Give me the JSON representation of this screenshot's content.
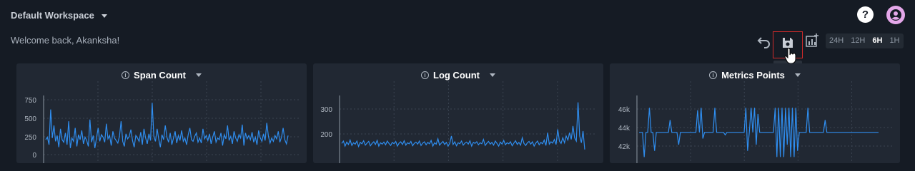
{
  "header": {
    "workspace_label": "Default Workspace",
    "welcome_text": "Welcome back, Akanksha!",
    "help_glyph": "?"
  },
  "toolbar": {
    "save_tooltip": "Save",
    "time_ranges": [
      "24H",
      "12H",
      "6H",
      "1H"
    ],
    "active_range": "6H"
  },
  "panels": [
    {
      "title": "Span Count",
      "info_glyph": "i"
    },
    {
      "title": "Log Count",
      "info_glyph": "i"
    },
    {
      "title": "Metrics Points",
      "info_glyph": "i"
    }
  ],
  "chart_data": [
    {
      "type": "line",
      "title": "Span Count",
      "yticks": [
        "750",
        "500",
        "250",
        "0"
      ],
      "ylim": [
        0,
        850
      ],
      "series": [
        {
          "color": "#2f8ef0",
          "values": [
            280,
            310,
            220,
            640,
            300,
            450,
            260,
            330,
            190,
            410,
            280,
            250,
            360,
            220,
            500,
            180,
            300,
            260,
            420,
            200,
            340,
            280,
            390,
            230,
            310,
            270,
            200,
            520,
            250,
            330,
            180,
            300,
            420,
            260,
            340,
            310,
            250,
            470,
            290,
            330,
            210,
            380,
            300,
            270,
            240,
            320,
            500,
            260,
            200,
            350,
            290,
            320,
            400,
            270,
            190,
            330,
            300,
            260,
            370,
            220,
            410,
            300,
            230,
            350,
            270,
            720,
            320,
            260,
            410,
            290,
            190,
            340,
            280,
            450,
            310,
            250,
            360,
            220,
            300,
            380,
            240,
            330,
            270,
            390,
            260,
            300,
            220,
            340,
            420,
            280,
            260,
            320,
            360,
            250,
            300,
            240,
            410,
            290,
            330,
            270,
            350,
            230,
            310,
            380,
            250,
            300,
            280,
            360,
            210,
            340,
            290,
            450,
            270,
            320,
            230,
            380,
            300,
            260,
            340,
            300,
            460,
            210,
            360,
            290,
            330,
            280,
            370,
            250,
            310,
            220,
            390,
            300,
            260,
            350,
            270,
            480,
            320,
            240,
            300,
            260,
            330,
            290,
            380,
            250,
            310,
            420,
            280,
            230,
            330
          ]
        }
      ],
      "grid": true
    },
    {
      "type": "line",
      "title": "Log Count",
      "yticks": [
        "300",
        "200"
      ],
      "ylim": [
        150,
        330
      ],
      "series": [
        {
          "color": "#2f8ef0",
          "values": [
            198,
            205,
            190,
            202,
            195,
            208,
            192,
            200,
            196,
            205,
            189,
            201,
            197,
            206,
            193,
            199,
            204,
            191,
            198,
            203,
            195,
            207,
            190,
            200,
            196,
            202,
            194,
            205,
            198,
            192,
            201,
            197,
            204,
            190,
            199,
            203,
            195,
            206,
            193,
            200,
            197,
            204,
            191,
            198,
            202,
            196,
            205,
            192,
            199,
            203,
            194,
            201,
            197,
            207,
            190,
            200,
            196,
            212,
            193,
            199,
            204,
            195,
            201,
            190,
            198,
            220,
            195,
            203,
            191,
            200,
            197,
            205,
            193,
            199,
            202,
            196,
            206,
            190,
            201,
            198,
            203,
            194,
            200,
            197,
            210,
            192,
            199,
            204,
            196,
            201,
            193,
            205,
            198,
            190,
            202,
            196,
            207,
            194,
            200,
            197,
            203,
            191,
            199,
            206,
            195,
            201,
            193,
            215,
            198,
            192,
            200,
            204,
            196,
            203,
            190,
            199,
            205,
            194,
            201,
            197,
            208,
            192,
            230,
            196,
            203,
            199,
            210,
            195,
            240,
            205,
            198,
            215,
            200,
            220,
            208,
            230,
            210,
            250,
            215,
            205,
            320,
            220,
            200,
            235,
            180
          ]
        }
      ],
      "grid": true
    },
    {
      "type": "line",
      "title": "Metrics Points",
      "yticks": [
        "46k",
        "44k",
        "42k"
      ],
      "ylim": [
        41500,
        47000
      ],
      "series": [
        {
          "color": "#2f8ef0",
          "values": [
            44000,
            44000,
            44000,
            42000,
            44000,
            44000,
            46000,
            44000,
            44000,
            42500,
            44000,
            44000,
            44000,
            44000,
            44000,
            44000,
            44000,
            44000,
            45000,
            44000,
            44000,
            44000,
            44000,
            43000,
            44000,
            44000,
            44000,
            44000,
            44000,
            44000,
            44000,
            44000,
            44000,
            44000,
            45800,
            44000,
            46000,
            43500,
            44000,
            44000,
            44000,
            44000,
            44000,
            44000,
            46000,
            44000,
            44000,
            44000,
            44000,
            44000,
            43800,
            44000,
            44000,
            44000,
            44000,
            44000,
            44000,
            44000,
            44000,
            44000,
            44000,
            44000,
            46000,
            42500,
            44000,
            46000,
            44000,
            46000,
            43000,
            45500,
            44000,
            44000,
            44000,
            44000,
            44000,
            44000,
            44000,
            44000,
            44000,
            46000,
            42000,
            46000,
            42000,
            46000,
            42000,
            46000,
            43000,
            46000,
            42000,
            46000,
            42000,
            46000,
            42500,
            44000,
            44000,
            44000,
            44000,
            44000,
            46000,
            44000,
            44000,
            44000,
            44000,
            44000,
            44000,
            44000,
            44000,
            44000,
            45000,
            44000,
            44000,
            44000,
            44000,
            44000,
            44000,
            44000,
            44000,
            44000,
            44000,
            44000,
            44000,
            44000,
            44000,
            44000,
            44000,
            44000,
            44000,
            44000,
            44000,
            44000,
            44000,
            44000,
            44000,
            44000,
            44000,
            44000,
            44000,
            44000,
            44000,
            44000
          ]
        }
      ],
      "grid": true
    }
  ]
}
